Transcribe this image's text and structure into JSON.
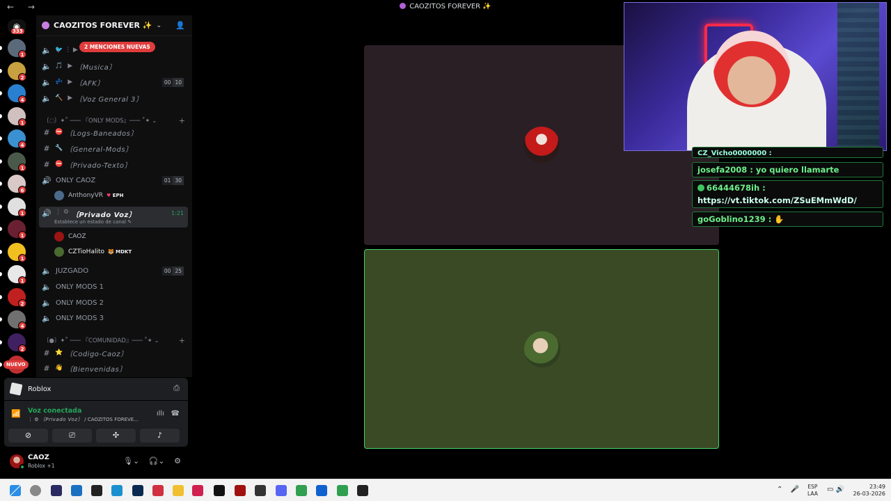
{
  "window": {
    "title": "CAOZITOS FOREVER ✨",
    "nav": "← →"
  },
  "rail": {
    "home_count": "333",
    "nuevo": "NUEVO",
    "servers": [
      {
        "color": "#5a6a7a",
        "badge": "1"
      },
      {
        "color": "#c8a040",
        "badge": "2"
      },
      {
        "color": "#2a80d0",
        "badge": "4"
      },
      {
        "color": "#d0c0c0",
        "badge": "1"
      },
      {
        "color": "#3a90d0",
        "badge": "4"
      },
      {
        "color": "#4a5a4a",
        "badge": "1"
      },
      {
        "color": "#d8c8c8",
        "badge": "6"
      },
      {
        "color": "#e0e0e0",
        "badge": "1"
      },
      {
        "color": "#6a2030",
        "badge": "1"
      },
      {
        "color": "#f0c020",
        "badge": "1"
      },
      {
        "color": "#e8e8e8",
        "badge": "1"
      },
      {
        "color": "#c02020",
        "badge": "2"
      },
      {
        "color": "#707070",
        "badge": "4"
      },
      {
        "color": "#402060",
        "badge": "2"
      },
      {
        "color": "#c03030",
        "badge": ""
      }
    ]
  },
  "sidebar": {
    "server_name": "CAOZITOS FOREVER ✨",
    "mentions": "2 MENCIONES NUEVAS",
    "channels_top": [
      {
        "name": "〔Musica〕",
        "icon": "🎵"
      },
      {
        "name": "〔AFK〕",
        "icon": "💤",
        "c1": "00",
        "c2": "10"
      },
      {
        "name": "〔Voz General 3〕",
        "icon": "🔨"
      }
    ],
    "cat_mods": "〔◌〕✦˚ ─── 『ONLY MODS』─── ˚✦ ⌄",
    "mod_channels": [
      {
        "name": "〔Logs-Baneados〕",
        "icon": "⛔"
      },
      {
        "name": "〔General-Mods〕",
        "icon": "🔧"
      },
      {
        "name": "〔Privado-Texto〕",
        "icon": "⛔"
      }
    ],
    "only_caoz": {
      "name": "ONLY CAOZ",
      "c1": "01",
      "c2": "30"
    },
    "member_anthony": {
      "name": "AnthonyVR",
      "tag": "EPH"
    },
    "privado_voz": {
      "name": "〔Privado Voz〕",
      "time": "1:21",
      "sub": "Establece un estado de canal ✎"
    },
    "member_caoz": {
      "name": "CAOZ"
    },
    "member_tio": {
      "name": "CZTioHalito",
      "tag": "MDKT"
    },
    "juzgado": {
      "name": "JUZGADO",
      "c1": "00",
      "c2": "25"
    },
    "mods_voice": [
      "ONLY MODS 1",
      "ONLY MODS 2",
      "ONLY MODS 3"
    ],
    "cat_comunidad": "〔●〕✦˚ ─── 『COMUNIDAD』─── ˚✦ ⌄",
    "com_channels": [
      {
        "name": "〔Codigo-Caoz〕",
        "icon": "⭐"
      },
      {
        "name": "〔Bienvenidas〕",
        "icon": "👋"
      }
    ]
  },
  "activity": {
    "name": "Roblox"
  },
  "voice": {
    "status": "Voz conectada",
    "channel": "〔Privado Voz〕",
    "server": "/ CAOZITOS FOREVE..."
  },
  "user": {
    "name": "CAOZ",
    "status": "Roblox +1"
  },
  "chat": [
    {
      "user": "josefa2008",
      "text": "yo quiero llamarte"
    },
    {
      "user": "66444678ih",
      "text": "https://vt.tiktok.com/ZSuEMmWdD/"
    },
    {
      "user": "goGoblino1239",
      "text": ""
    }
  ],
  "chat_partial": "CZ_Vicho0000000 :",
  "tray": {
    "lang1": "ESP",
    "lang2": "LAA",
    "time": "23:49",
    "date": "26-03-2026"
  }
}
